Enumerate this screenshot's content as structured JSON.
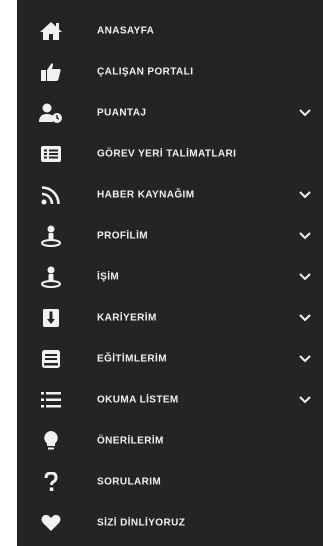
{
  "menu": {
    "items": [
      {
        "label": "ANASAYFA",
        "icon": "home-icon",
        "expandable": false
      },
      {
        "label": "ÇALIŞAN PORTALI",
        "icon": "thumbs-up-icon",
        "expandable": false
      },
      {
        "label": "PUANTAJ",
        "icon": "user-clock-icon",
        "expandable": true
      },
      {
        "label": "GÖREV YERİ TALİMATLARI",
        "icon": "list-card-icon",
        "expandable": false
      },
      {
        "label": "HABER KAYNAĞIM",
        "icon": "rss-icon",
        "expandable": true
      },
      {
        "label": "PROFİLİM",
        "icon": "person-icon",
        "expandable": true
      },
      {
        "label": "İŞİM",
        "icon": "person-icon",
        "expandable": true
      },
      {
        "label": "KARİYERİM",
        "icon": "ladder-icon",
        "expandable": true
      },
      {
        "label": "EĞİTİMLERİM",
        "icon": "book-icon",
        "expandable": true
      },
      {
        "label": "OKUMA LİSTEM",
        "icon": "list-icon",
        "expandable": true
      },
      {
        "label": "ÖNERİLERİM",
        "icon": "lightbulb-icon",
        "expandable": false
      },
      {
        "label": "SORULARIM",
        "icon": "question-icon",
        "expandable": false
      },
      {
        "label": "SİZİ DİNLİYORUZ",
        "icon": "heart-icon",
        "expandable": false
      }
    ]
  },
  "colors": {
    "background": "#242424",
    "text": "#f1f1f1"
  }
}
